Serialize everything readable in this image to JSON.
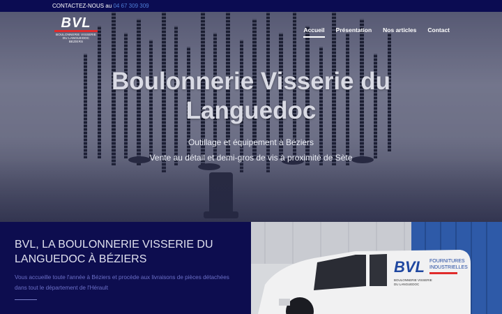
{
  "topbar": {
    "contact_label": "CONTACTEZ-NOUS au",
    "phone": "04 67 309 309"
  },
  "logo": {
    "mark": "BVL",
    "subtitle_line1": "BOULONNERIE VISSERIE",
    "subtitle_line2": "DU LANGUEDOC",
    "subtitle_line3": "BEZIERS"
  },
  "nav": {
    "items": [
      {
        "label": "Accueil",
        "active": true
      },
      {
        "label": "Présentation"
      },
      {
        "label": "Nos articles"
      },
      {
        "label": "Contact"
      }
    ]
  },
  "hero": {
    "title_line1": "Boulonnerie Visserie du",
    "title_line2": "Languedoc",
    "subtitle1": "Outillage et équipement à Béziers",
    "subtitle2": "Vente au détail et demi-gros de vis à proximité de Sète"
  },
  "intro": {
    "heading_line1": "BVL, LA BOULONNERIE VISSERIE DU",
    "heading_line2": "LANGUEDOC À BÉZIERS",
    "body": "Vous accueille toute l'année à Béziers et procède aux livraisons de pièces détachées dans tout le département de l'Hérault"
  },
  "van": {
    "brand": "BVL",
    "tag_line1": "FOURNITURES",
    "tag_line2": "INDUSTRIELLES",
    "company_line1": "BOULONNERIE VISSERIE",
    "company_line2": "DU LANGUEDOC"
  },
  "colors": {
    "navy": "#0b0c52",
    "accent_red": "#e02b2b",
    "phone_blue": "#4f7fd8"
  }
}
